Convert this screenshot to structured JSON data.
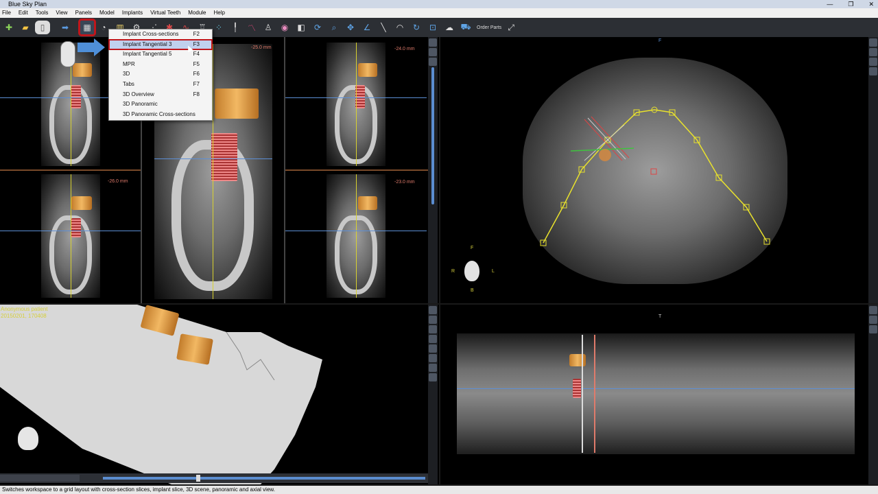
{
  "window": {
    "title": "Blue Sky Plan",
    "min": "—",
    "max": "❐",
    "close": "✕"
  },
  "menubar": [
    "File",
    "Edit",
    "Tools",
    "View",
    "Panels",
    "Model",
    "Implants",
    "Virtual Teeth",
    "Module",
    "Help"
  ],
  "toolbar": {
    "order_parts": "Order Parts"
  },
  "menu": [
    {
      "label": "Implant Cross-sections",
      "key": "F2"
    },
    {
      "label": "Implant Tangential 3",
      "key": "F3"
    },
    {
      "label": "Implant Tangential 5",
      "key": "F4"
    },
    {
      "label": "MPR",
      "key": "F5"
    },
    {
      "label": "3D",
      "key": "F6"
    },
    {
      "label": "Tabs",
      "key": "F7"
    },
    {
      "label": "3D Overview",
      "key": "F8"
    },
    {
      "label": "3D Panoramic",
      "key": ""
    },
    {
      "label": "3D Panoramic Cross-sections",
      "key": ""
    }
  ],
  "views": {
    "center_offset": "-25.0 mm",
    "tr_offset": "-24.0 mm",
    "bl_offset": "-26.0 mm",
    "br_offset": "-23.0 mm",
    "axial_top": "F",
    "orient": {
      "f": "F",
      "r": "R",
      "l": "L",
      "b": "B"
    },
    "pano_top": "T"
  },
  "patient": {
    "name": "Anonymous patient",
    "id": "20150201, 170408"
  },
  "status": "Switches workspace to a grid layout with cross-section slices, implant slice, 3D scene, panoramic and axial view."
}
